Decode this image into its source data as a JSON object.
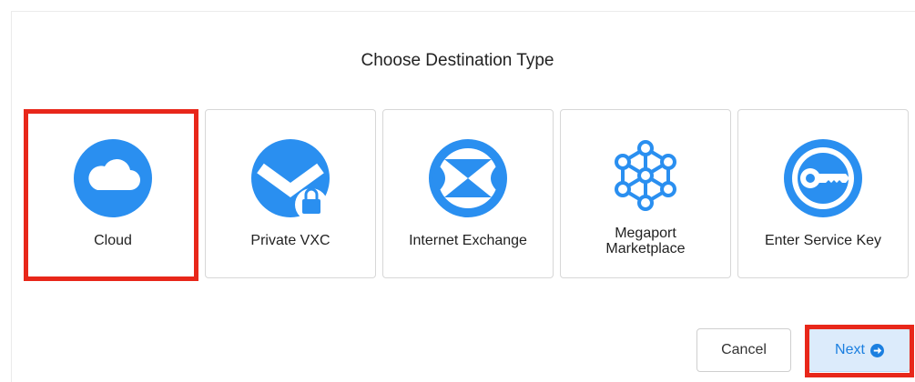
{
  "dialog": {
    "title": "Choose Destination Type"
  },
  "options": [
    {
      "label": "Cloud",
      "icon": "cloud-icon",
      "selected": true
    },
    {
      "label": "Private VXC",
      "icon": "vxc-lock-icon",
      "selected": false
    },
    {
      "label": "Internet Exchange",
      "icon": "internet-exchange-icon",
      "selected": false
    },
    {
      "label_line1": "Megaport",
      "label_line2": "Marketplace",
      "icon": "network-nodes-icon",
      "selected": false
    },
    {
      "label": "Enter Service Key",
      "icon": "key-icon",
      "selected": false
    }
  ],
  "buttons": {
    "cancel": "Cancel",
    "next": "Next"
  },
  "colors": {
    "accent_blue": "#2a8ff0",
    "highlight_red": "#e8271a",
    "next_bg": "#dcebfb"
  }
}
